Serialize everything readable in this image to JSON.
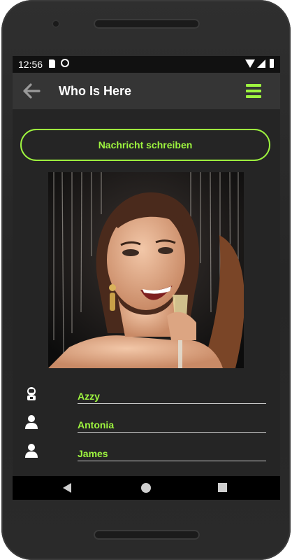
{
  "status_bar": {
    "time": "12:56"
  },
  "app_bar": {
    "title": "Who Is Here",
    "back_icon": "arrow-left-icon",
    "menu_icon": "hamburger-menu-icon"
  },
  "message_button": {
    "label": "Nachricht schreiben"
  },
  "photo": {
    "subject": "profile-photo"
  },
  "users": [
    {
      "name": "Azzy",
      "icon": "astronaut-icon"
    },
    {
      "name": "Antonia",
      "icon": "person-icon"
    },
    {
      "name": "James",
      "icon": "person-icon"
    }
  ],
  "colors": {
    "accent": "#9ef53f",
    "background": "#252525",
    "app_bar": "#353535"
  }
}
